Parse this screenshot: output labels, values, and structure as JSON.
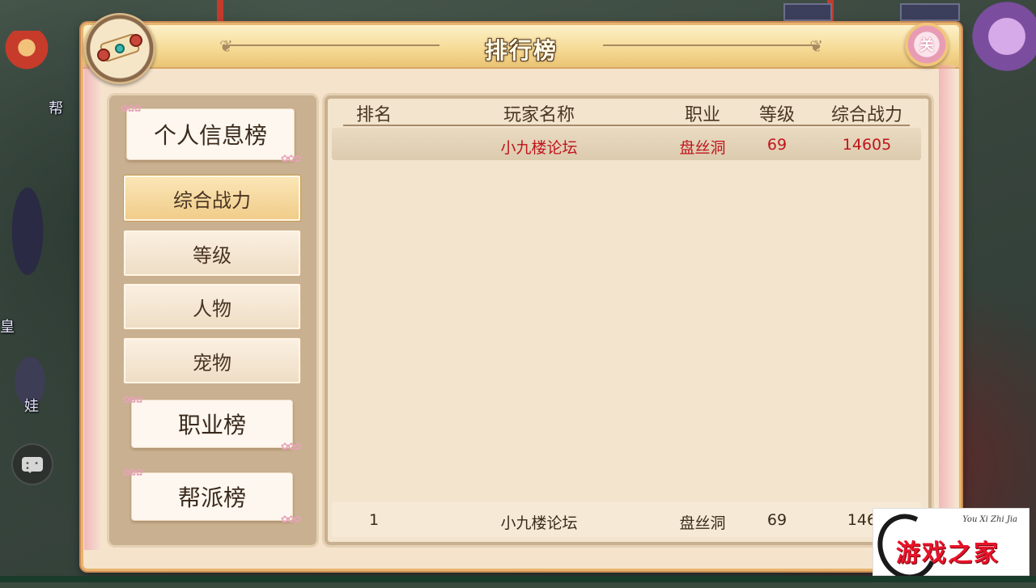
{
  "world": {
    "npc_label_1": "皇",
    "npc_label_2": "娃",
    "npc_label_3": "帮"
  },
  "panel": {
    "title": "排行榜",
    "close_label": "关"
  },
  "menu": {
    "personal_tab": "个人信息榜",
    "sub_items": [
      "综合战力",
      "等级",
      "人物",
      "宠物"
    ],
    "active_index": 0,
    "career_tab": "职业榜",
    "guild_tab": "帮派榜"
  },
  "table": {
    "headers": {
      "rank": "排名",
      "name": "玩家名称",
      "job": "职业",
      "level": "等级",
      "power": "综合战力"
    },
    "rows": [
      {
        "rank_icon": "gold-medal-icon",
        "name": "小九楼论坛",
        "job": "盘丝洞",
        "level": "69",
        "power": "14605"
      }
    ],
    "self_row": {
      "rank": "1",
      "name": "小九楼论坛",
      "job": "盘丝洞",
      "level": "69",
      "power": "1460"
    }
  },
  "logo": {
    "pinyin": "You Xi Zhi Jia",
    "text": "游戏之家"
  },
  "colors": {
    "highlight_text": "#c0141c",
    "panel_bg": "#f6e3cc",
    "header_gold": "#f5d992",
    "active_button": "#f0cc88"
  }
}
